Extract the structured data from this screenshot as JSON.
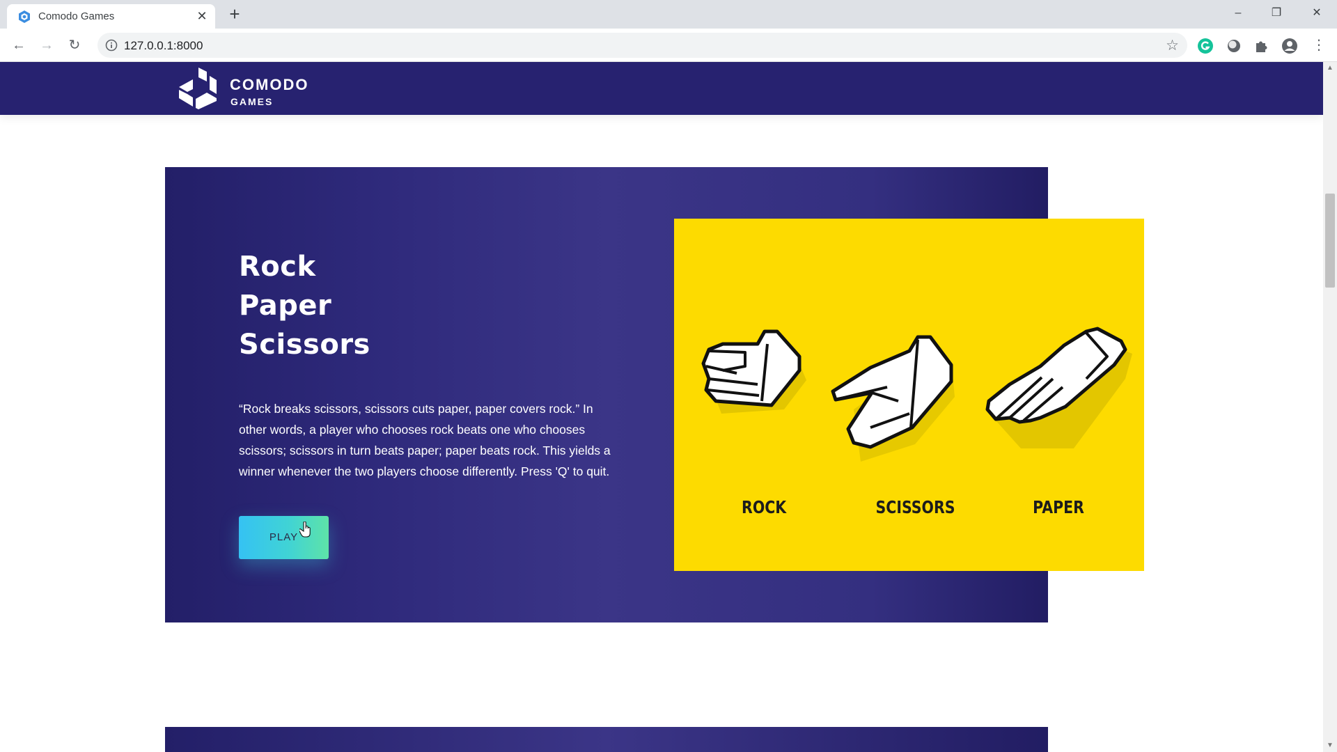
{
  "browser": {
    "tab_title": "Comodo Games",
    "tab_close": "✕",
    "new_tab": "+",
    "url": "127.0.0.1:8000",
    "window_controls": {
      "minimize": "–",
      "maximize": "❐",
      "close": "✕"
    },
    "nav": {
      "back": "←",
      "forward": "→",
      "reload": "↻"
    },
    "star": "☆",
    "menu": "⋮"
  },
  "site": {
    "logo_line1": "COMODO",
    "logo_line2": "GAMES",
    "colors": {
      "header": "#272270",
      "hero": "#332e80",
      "accent_yellow": "#fddb00",
      "button_start": "#35c2f3",
      "button_end": "#5ee3a8"
    }
  },
  "game": {
    "title_lines": [
      "Rock",
      "Paper",
      "Scissors"
    ],
    "description": "“Rock breaks scissors, scissors cuts paper, paper covers rock.” In other words, a player who chooses rock beats one who chooses scissors; scissors in turn beats paper; paper beats rock. This yields a winner whenever the two players choose differently. Press 'Q' to quit.",
    "play_label": "PLAY",
    "hands": [
      {
        "label": "ROCK",
        "icon": "rock-hand-icon"
      },
      {
        "label": "SCISSORS",
        "icon": "scissors-hand-icon"
      },
      {
        "label": "PAPER",
        "icon": "paper-hand-icon"
      }
    ]
  }
}
